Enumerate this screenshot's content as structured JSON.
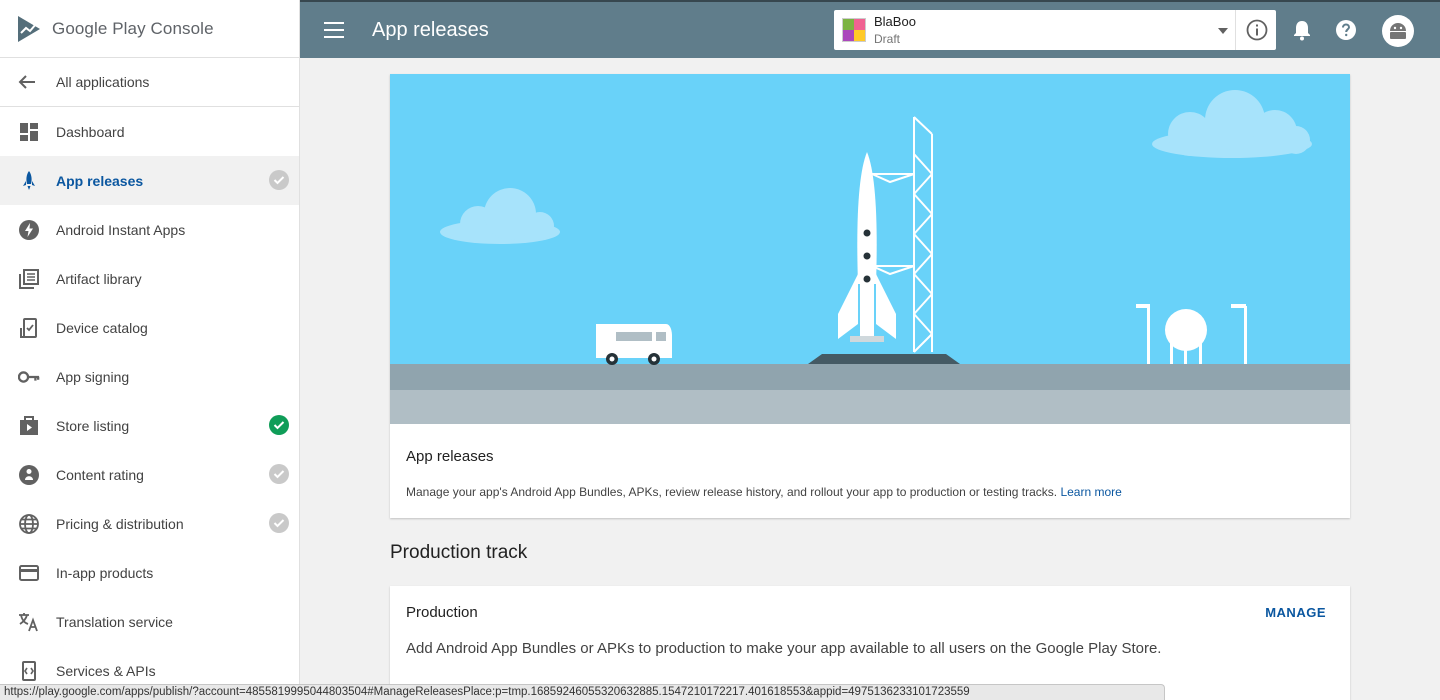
{
  "brand": {
    "name_primary": "Google Play",
    "name_secondary": "Console"
  },
  "sidebar": {
    "back_label": "All applications",
    "items": [
      {
        "label": "Dashboard",
        "icon": "dashboard-icon"
      },
      {
        "label": "App releases",
        "icon": "rocket-icon",
        "active": true,
        "status": "incomplete"
      },
      {
        "label": "Android Instant Apps",
        "icon": "instant-apps-icon"
      },
      {
        "label": "Artifact library",
        "icon": "artifact-library-icon"
      },
      {
        "label": "Device catalog",
        "icon": "device-catalog-icon"
      },
      {
        "label": "App signing",
        "icon": "key-icon"
      },
      {
        "label": "Store listing",
        "icon": "store-listing-icon",
        "status": "complete"
      },
      {
        "label": "Content rating",
        "icon": "content-rating-icon",
        "status": "incomplete"
      },
      {
        "label": "Pricing & distribution",
        "icon": "globe-icon",
        "status": "incomplete"
      },
      {
        "label": "In-app products",
        "icon": "credit-card-icon"
      },
      {
        "label": "Translation service",
        "icon": "translate-icon"
      },
      {
        "label": "Services & APIs",
        "icon": "services-icon"
      }
    ]
  },
  "header": {
    "title": "App releases",
    "app": {
      "name": "BlaBoo",
      "status": "Draft"
    }
  },
  "hero": {
    "title": "App releases",
    "description": "Manage your app's Android App Bundles, APKs, review release history, and rollout your app to production or testing tracks.",
    "link": "Learn more"
  },
  "production_track": {
    "section_title": "Production track",
    "title": "Production",
    "action": "MANAGE",
    "description": "Add Android App Bundles or APKs to production to make your app available to all users on the Google Play Store."
  },
  "status_bar": {
    "url": "https://play.google.com/apps/publish/?account=4855819995044803504#ManageReleasesPlace:p=tmp.16859246055320632885.1547210172217.401618553&appid=4975136233101723559"
  },
  "colors": {
    "topbar": "#607d8b",
    "accent": "#0b57a0",
    "complete": "#0f9d58",
    "incomplete": "#c9c9c9",
    "sky": "#69d2f9"
  }
}
